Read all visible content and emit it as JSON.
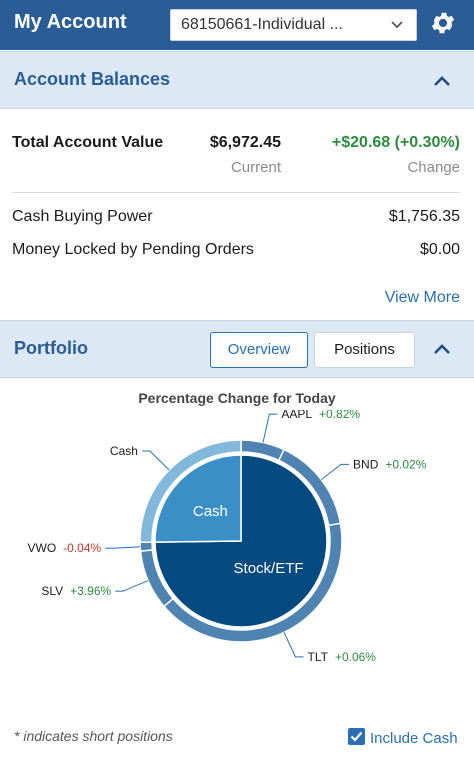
{
  "header": {
    "title": "My Account",
    "account_select": "68150661-Individual ..."
  },
  "balances": {
    "title": "Account Balances",
    "total_label": "Total Account Value",
    "total_value": "$6,972.45",
    "total_value_caption": "Current",
    "change_value": "+$20.68 (+0.30%)",
    "change_caption": "Change",
    "cash_buying_power_label": "Cash Buying Power",
    "cash_buying_power_value": "$1,756.35",
    "locked_label": "Money Locked by Pending Orders",
    "locked_value": "$0.00",
    "view_more": "View More"
  },
  "portfolio": {
    "title": "Portfolio",
    "tabs": [
      "Overview",
      "Positions"
    ],
    "active_tab": "Overview"
  },
  "chart_data": {
    "type": "pie",
    "title": "Percentage Change for Today",
    "inner": [
      {
        "label": "Cash",
        "share": 25.2,
        "color": "#3a8fc7"
      },
      {
        "label": "Stock/ETF",
        "share": 74.8,
        "color": "#034a80"
      }
    ],
    "outer": [
      {
        "label": "AAPL",
        "change": "+0.82%",
        "share": 7.0
      },
      {
        "label": "BND",
        "change": "+0.02%",
        "share": 15.2
      },
      {
        "label": "TLT",
        "change": "+0.06%",
        "share": 41.6
      },
      {
        "label": "SLV",
        "change": "+3.96%",
        "share": 9.6
      },
      {
        "label": "VWO",
        "change": "-0.04%",
        "share": 1.4
      },
      {
        "label": "Cash",
        "change": "",
        "share": 25.2
      }
    ],
    "outer_colors": {
      "holding": "#4f84b2",
      "cash": "#82b8dc"
    },
    "change_colors": {
      "positive": "#2e8b3e",
      "negative": "#c0392b"
    }
  },
  "footer": {
    "note": "* indicates short positions",
    "include_cash": "Include Cash",
    "include_cash_checked": true
  }
}
